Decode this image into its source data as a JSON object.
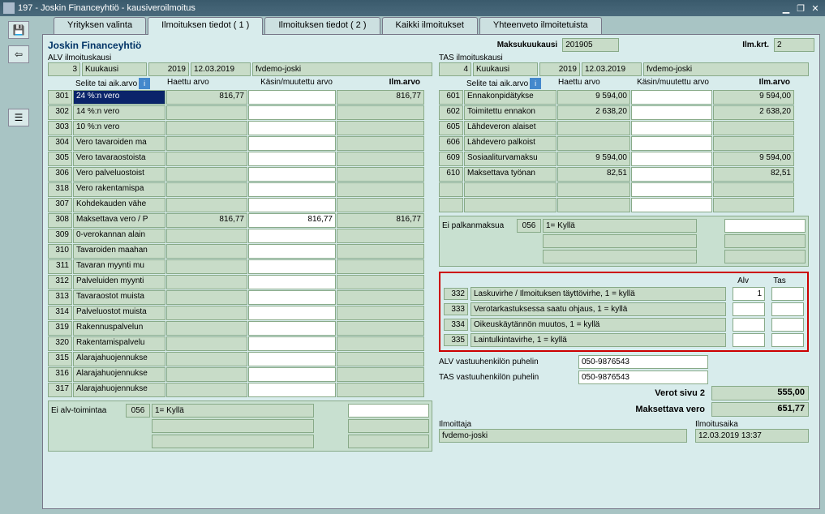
{
  "window": {
    "title": "197 - Joskin Financeyhtiö - kausiveroilmoitus"
  },
  "tabs": {
    "t1": "Yrityksen valinta",
    "t2": "Ilmoituksen tiedot ( 1 )",
    "t3": "Ilmoituksen tiedot ( 2 )",
    "t4": "Kaikki ilmoitukset",
    "t5": "Yhteenveto ilmoitetuista"
  },
  "company": "Joskin Financeyhtiö",
  "maksukuukausi_lbl": "Maksukuukausi",
  "maksukuukausi_val": "201905",
  "ilmkrt_lbl": "Ilm.krt.",
  "ilmkrt_val": "2",
  "alv": {
    "caption": "ALV ilmoituskausi",
    "no": "3",
    "period": "Kuukausi",
    "year": "2019",
    "date": "12.03.2019",
    "user": "fvdemo-joski"
  },
  "tas": {
    "caption": "TAS ilmoituskausi",
    "no": "4",
    "period": "Kuukausi",
    "year": "2019",
    "date": "12.03.2019",
    "user": "fvdemo-joski"
  },
  "headers": {
    "selite": "Selite tai aik.arvo",
    "haettu": "Haettu arvo",
    "kasin": "Käsin/muutettu arvo",
    "ilm": "Ilm.arvo"
  },
  "gridL": [
    {
      "c": "301",
      "d": "24 %:n vero",
      "v1": "816,77",
      "v2": "",
      "v3": "816,77",
      "sel": true
    },
    {
      "c": "302",
      "d": "14 %:n vero",
      "v1": "",
      "v2": "",
      "v3": ""
    },
    {
      "c": "303",
      "d": "10 %:n vero",
      "v1": "",
      "v2": "",
      "v3": ""
    },
    {
      "c": "304",
      "d": "Vero tavaroiden ma",
      "v1": "",
      "v2": "",
      "v3": ""
    },
    {
      "c": "305",
      "d": "Vero tavaraostoista",
      "v1": "",
      "v2": "",
      "v3": ""
    },
    {
      "c": "306",
      "d": "Vero palveluostoist",
      "v1": "",
      "v2": "",
      "v3": ""
    },
    {
      "c": "318",
      "d": "Vero rakentamispa",
      "v1": "",
      "v2": "",
      "v3": ""
    },
    {
      "c": "307",
      "d": "Kohdekauden vähe",
      "v1": "",
      "v2": "",
      "v3": ""
    },
    {
      "c": "308",
      "d": "Maksettava vero / P",
      "v1": "816,77",
      "v2": "816,77",
      "v3": "816,77"
    },
    {
      "c": "309",
      "d": "0-verokannan alain",
      "v1": "",
      "v2": "",
      "v3": ""
    },
    {
      "c": "310",
      "d": "Tavaroiden maahan",
      "v1": "",
      "v2": "",
      "v3": ""
    },
    {
      "c": "311",
      "d": "Tavaran myynti mu",
      "v1": "",
      "v2": "",
      "v3": ""
    },
    {
      "c": "312",
      "d": "Palveluiden myynti",
      "v1": "",
      "v2": "",
      "v3": ""
    },
    {
      "c": "313",
      "d": "Tavaraostot muista",
      "v1": "",
      "v2": "",
      "v3": ""
    },
    {
      "c": "314",
      "d": "Palveluostot muista",
      "v1": "",
      "v2": "",
      "v3": ""
    },
    {
      "c": "319",
      "d": "Rakennuspalvelun",
      "v1": "",
      "v2": "",
      "v3": ""
    },
    {
      "c": "320",
      "d": "Rakentamispalvelu",
      "v1": "",
      "v2": "",
      "v3": ""
    },
    {
      "c": "315",
      "d": "Alarajahuojennukse",
      "v1": "",
      "v2": "",
      "v3": ""
    },
    {
      "c": "316",
      "d": "Alarajahuojennukse",
      "v1": "",
      "v2": "",
      "v3": ""
    },
    {
      "c": "317",
      "d": "Alarajahuojennukse",
      "v1": "",
      "v2": "",
      "v3": ""
    }
  ],
  "gridR": [
    {
      "c": "601",
      "d": "Ennakonpidätykse",
      "v1": "9 594,00",
      "v2": "",
      "v3": "9 594,00"
    },
    {
      "c": "602",
      "d": "Toimitettu ennakon",
      "v1": "2 638,20",
      "v2": "",
      "v3": "2 638,20"
    },
    {
      "c": "605",
      "d": "Lähdeveron alaiset",
      "v1": "",
      "v2": "",
      "v3": ""
    },
    {
      "c": "606",
      "d": "Lähdevero palkoist",
      "v1": "",
      "v2": "",
      "v3": ""
    },
    {
      "c": "609",
      "d": "Sosiaaliturvamaksu",
      "v1": "9 594,00",
      "v2": "",
      "v3": "9 594,00"
    },
    {
      "c": "610",
      "d": "Maksettava työnan",
      "v1": "82,51",
      "v2": "",
      "v3": "82,51"
    },
    {
      "c": "",
      "d": "",
      "v1": "",
      "v2": "",
      "v3": ""
    },
    {
      "c": "",
      "d": "",
      "v1": "",
      "v2": "",
      "v3": ""
    }
  ],
  "ei_alv": {
    "label": "Ei alv-toimintaa",
    "code": "056",
    "kylla": "1= Kyllä"
  },
  "ei_palkka": {
    "label": "Ei palkanmaksua",
    "code": "056",
    "kylla": "1= Kyllä"
  },
  "red": {
    "alv": "Alv",
    "tas": "Tas",
    "rows": [
      {
        "c": "332",
        "d": "Laskuvirhe / Ilmoituksen täyttövirhe, 1 = kyllä",
        "alv": "1",
        "tas": ""
      },
      {
        "c": "333",
        "d": "Verotarkastuksessa saatu ohjaus, 1 = kyllä",
        "alv": "",
        "tas": ""
      },
      {
        "c": "334",
        "d": "Oikeuskäytännön muutos, 1 = kyllä",
        "alv": "",
        "tas": ""
      },
      {
        "c": "335",
        "d": "Laintulkintavirhe, 1 = kyllä",
        "alv": "",
        "tas": ""
      }
    ]
  },
  "alv_vast": {
    "lbl": "ALV vastuuhenkilön puhelin",
    "val": "050-9876543"
  },
  "tas_vast": {
    "lbl": "TAS vastuuhenkilön puhelin",
    "val": "050-9876543"
  },
  "sums": {
    "s1l": "Verot sivu 2",
    "s1v": "555,00",
    "s2l": "Maksettava vero",
    "s2v": "651,77"
  },
  "footer": {
    "ilmoittaja_lbl": "Ilmoittaja",
    "ilmoittaja_val": "fvdemo-joski",
    "aika_lbl": "Ilmoitusaika",
    "aika_val": "12.03.2019 13:37"
  }
}
